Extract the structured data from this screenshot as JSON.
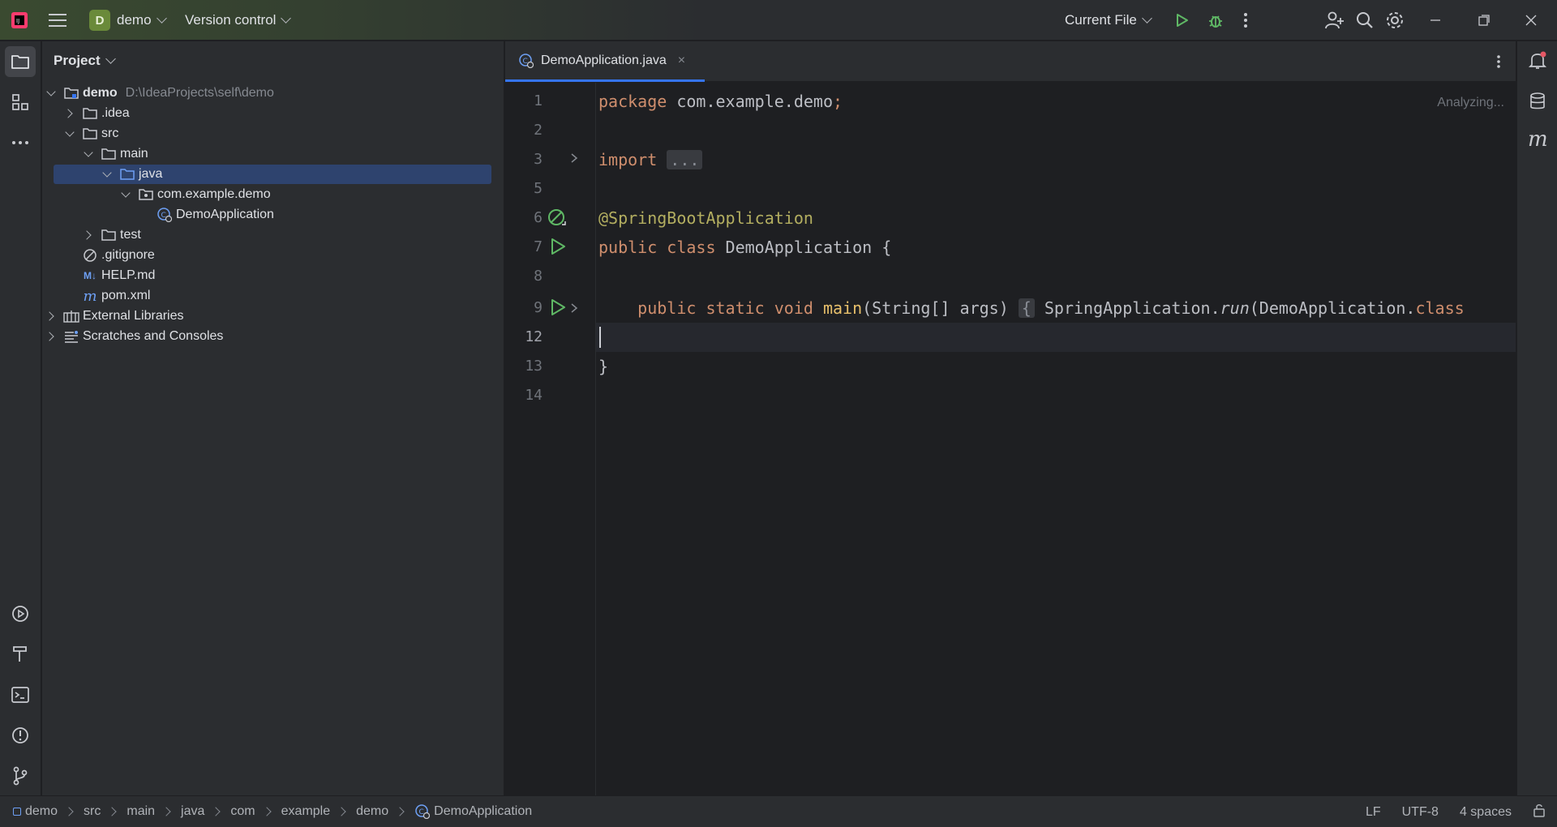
{
  "titlebar": {
    "project_badge": "D",
    "project_name": "demo",
    "vcs_label": "Version control",
    "run_config": "Current File"
  },
  "project_panel": {
    "title": "Project",
    "tree": [
      {
        "label": "demo",
        "path": "D:\\IdeaProjects\\self\\demo"
      },
      {
        "label": ".idea"
      },
      {
        "label": "src"
      },
      {
        "label": "main"
      },
      {
        "label": "java"
      },
      {
        "label": "com.example.demo"
      },
      {
        "label": "DemoApplication"
      },
      {
        "label": "test"
      },
      {
        "label": ".gitignore"
      },
      {
        "label": "HELP.md"
      },
      {
        "label": "pom.xml"
      },
      {
        "label": "External Libraries"
      },
      {
        "label": "Scratches and Consoles"
      }
    ]
  },
  "editor": {
    "tab_label": "DemoApplication.java",
    "tab_close": "×",
    "status_hint": "Analyzing...",
    "line_numbers": [
      "1",
      "2",
      "3",
      "5",
      "6",
      "7",
      "8",
      "9",
      "12",
      "13",
      "14"
    ],
    "code": {
      "l1_kw": "package",
      "l1_rest": " com.example.demo",
      "l1_semi": ";",
      "l3_kw": "import",
      "l3_fold": "...",
      "l6_ann": "@SpringBootApplication",
      "l7_kw": "public class",
      "l7_rest": " DemoApplication {",
      "l9_kw": "    public static void",
      "l9_fn": " main",
      "l9_args": "(String[] args)",
      "l9_fold": "{",
      "l9_body1": " SpringApplication.",
      "l9_run": "run",
      "l9_body2": "(DemoApplication.",
      "l9_class": "class",
      "l13": "}"
    }
  },
  "statusbar": {
    "breadcrumbs": [
      "demo",
      "src",
      "main",
      "java",
      "com",
      "example",
      "demo",
      "DemoApplication"
    ],
    "line_sep": "LF",
    "encoding": "UTF-8",
    "indent": "4 spaces"
  }
}
